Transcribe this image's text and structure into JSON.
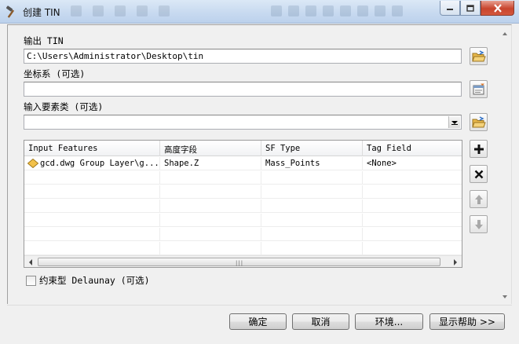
{
  "window": {
    "title": "创建 TIN",
    "icon": "hammer-icon"
  },
  "fields": {
    "output_label": "输出 TIN",
    "output_value": "C:\\Users\\Administrator\\Desktop\\tin",
    "coord_label": "坐标系 (可选)",
    "coord_value": "",
    "input_label": "输入要素类 (可选)",
    "input_value": ""
  },
  "grid": {
    "columns": [
      "Input Features",
      "高度字段",
      "SF Type",
      "Tag Field"
    ],
    "rows": [
      [
        "gcd.dwg Group Layer\\g...",
        "Shape.Z",
        "Mass_Points",
        "<None>"
      ]
    ]
  },
  "options": {
    "delaunay_label": "约束型 Delaunay (可选)",
    "delaunay_checked": false
  },
  "footer": {
    "ok": "确定",
    "cancel": "取消",
    "environments": "环境...",
    "show_help": "显示帮助 >>"
  },
  "colors": {
    "folder": "#e8b84a",
    "add_plus": "#111111",
    "title_bar": "#c8daf0",
    "close_button": "#c8452e"
  }
}
